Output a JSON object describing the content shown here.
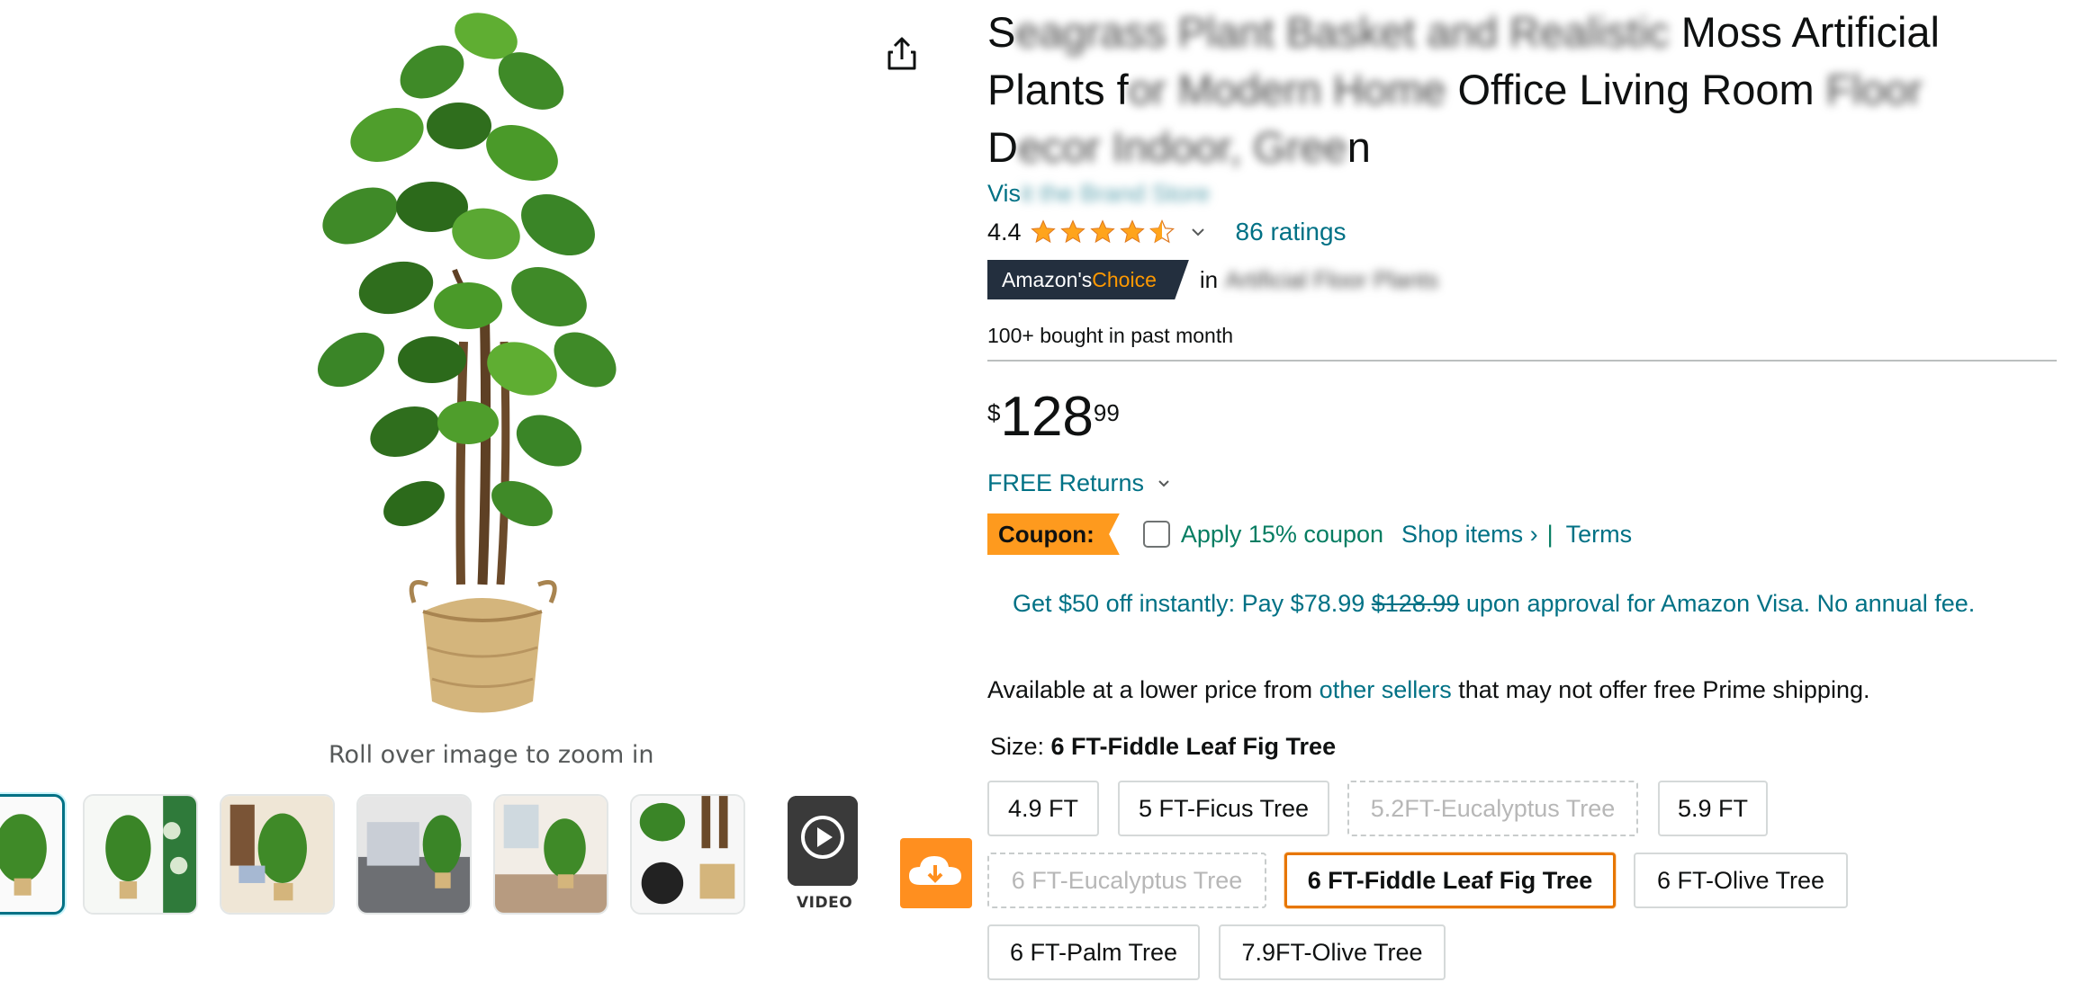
{
  "product": {
    "title_line1_visible": "S",
    "title_line1_blur": "eagrass Plant Basket and Realistic",
    "title_line1_end": " Moss Artificial",
    "title_line2_start": "Plants f",
    "title_line2_blur": "or Modern Home",
    "title_line2_mid": " Office Living Room ",
    "title_line2_blur2": "Floor",
    "title_line3_start": "D",
    "title_line3_blur": "ecor Indoor, Gree",
    "title_line3_end": "n",
    "store_prefix": "Vis",
    "store_blur": "it the Brand Store"
  },
  "rating": {
    "value": "4.4",
    "stars": 4.4,
    "count_label": "86 ratings"
  },
  "badge": {
    "amazons": "Amazon's ",
    "choice": "Choice",
    "in_label": "in",
    "category_blur": "Artificial Floor Plants"
  },
  "bought_label": "100+ bought in past month",
  "price": {
    "symbol": "$",
    "whole": "128",
    "fraction": "99"
  },
  "returns_label": "FREE Returns",
  "coupon": {
    "badge": "Coupon:",
    "text": "Apply 15% coupon",
    "shop_items": "Shop items ›",
    "pipe": "|",
    "terms": "Terms"
  },
  "visa_offer": {
    "pre": "Get $50 off instantly: Pay $78.99 ",
    "strike": "$128.99",
    "post": " upon approval for Amazon Visa. No annual fee."
  },
  "lower_price": {
    "pre": "Available at a lower price from ",
    "link": "other sellers",
    "post": " that may not offer free Prime shipping."
  },
  "size": {
    "label": "Size: ",
    "selected": "6 FT-Fiddle Leaf Fig Tree",
    "options": [
      "4.9 FT",
      "5 FT-Ficus Tree",
      "5.2FT-Eucalyptus Tree",
      "5.9 FT",
      "6 FT-Eucalyptus Tree",
      "6 FT-Fiddle Leaf Fig Tree",
      "6 FT-Olive Tree",
      "6 FT-Palm Tree",
      "7.9FT-Olive Tree"
    ]
  },
  "gallery": {
    "zoom_hint": "Roll over image to zoom in",
    "video_label": "VIDEO"
  },
  "colors": {
    "link": "#007185",
    "coupon_orange": "#fe9a1e",
    "selected_border": "#e77600",
    "star": "#ffa41c"
  }
}
